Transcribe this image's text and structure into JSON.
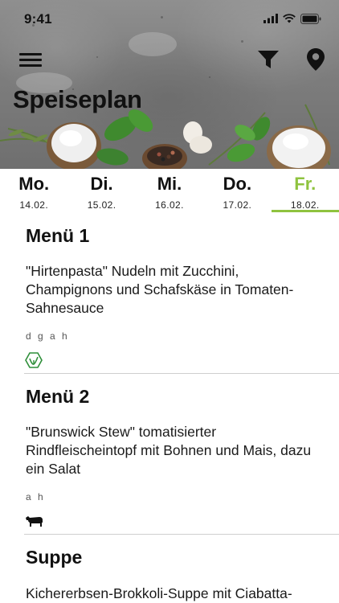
{
  "status_bar": {
    "time": "9:41"
  },
  "header": {
    "title": "Speiseplan",
    "icons": [
      "hamburger-menu-icon",
      "filter-icon",
      "location-pin-icon"
    ]
  },
  "days": [
    {
      "day": "Mo.",
      "date": "14.02.",
      "active": false
    },
    {
      "day": "Di.",
      "date": "15.02.",
      "active": false
    },
    {
      "day": "Mi.",
      "date": "16.02.",
      "active": false
    },
    {
      "day": "Do.",
      "date": "17.02.",
      "active": false
    },
    {
      "day": "Fr.",
      "date": "18.02.",
      "active": true
    }
  ],
  "accent_color": "#8fc33f",
  "menus": [
    {
      "title": "Menü 1",
      "description": "\"Hirtenpasta\" Nudeln mit Zucchini, Champignons und Schafskäse in Tomaten-Sahnesauce",
      "allergens": "d g a h",
      "icon": "vegetarian-leaf-icon"
    },
    {
      "title": "Menü 2",
      "description": "\"Brunswick Stew\" tomatisierter Rindfleischeintopf mit Bohnen und Mais, dazu ein Salat",
      "allergens": "a h",
      "icon": "beef-cow-icon"
    },
    {
      "title": "Suppe",
      "description": "Kichererbsen-Brokkoli-Suppe mit Ciabatta-"
    }
  ]
}
